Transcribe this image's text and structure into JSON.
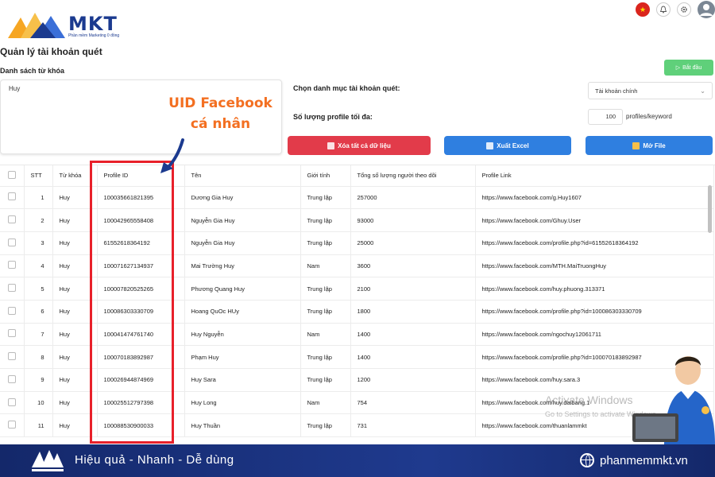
{
  "brand": {
    "name": "MKT",
    "subtitle": "Phần mềm Marketing 0 đồng",
    "primary": "#1b3a8f",
    "accent": "#f36f21"
  },
  "header": {
    "icons": [
      "vietnam-flag-icon",
      "bell-icon",
      "gear-icon",
      "avatar-icon"
    ]
  },
  "page": {
    "title": "Quản lý tài khoản quét",
    "keyword_section": "Danh sách từ khóa",
    "keyword_value": "Huy",
    "start_button": "Bắt đầu",
    "category_label": "Chọn danh mục tài khoản quét:",
    "category_value": "Tài khoản chính",
    "profile_count_label": "Số lượng profile tối đa:",
    "profile_count_value": "100",
    "profile_count_unit": "profiles/keyword",
    "btn_clear": "Xóa tất cả dữ liệu",
    "btn_excel": "Xuất Excel",
    "btn_file": "Mở File"
  },
  "annotation": {
    "line1": "UID Facebook",
    "line2": "cá nhân"
  },
  "table": {
    "headers": [
      "STT",
      "Từ khóa",
      "Profile ID",
      "Tên",
      "Giới tính",
      "Tổng số lượng người theo dõi",
      "Profile Link"
    ],
    "rows": [
      [
        "1",
        "Huy",
        "100035661821395",
        "Dương Gia Huy",
        "Trung lập",
        "257000",
        "https://www.facebook.com/g.Huy1607"
      ],
      [
        "2",
        "Huy",
        "100042965558408",
        "Nguyễn Gia Huy",
        "Trung lập",
        "93000",
        "https://www.facebook.com/Ghuy.User"
      ],
      [
        "3",
        "Huy",
        "61552618364192",
        "Nguyễn Gia Huy",
        "Trung lập",
        "25000",
        "https://www.facebook.com/profile.php?id=61552618364192"
      ],
      [
        "4",
        "Huy",
        "100071627134937",
        "Mai Trường Huy",
        "Nam",
        "3600",
        "https://www.facebook.com/MTH.MaiTruongHuy"
      ],
      [
        "5",
        "Huy",
        "100007820525265",
        "Phương Quang Huy",
        "Trung lập",
        "2100",
        "https://www.facebook.com/huy.phuong.313371"
      ],
      [
        "6",
        "Huy",
        "100086303330709",
        "Hoang QuOc HUy",
        "Trung lập",
        "1800",
        "https://www.facebook.com/profile.php?id=100086303330709"
      ],
      [
        "7",
        "Huy",
        "100041474761740",
        "Huy Nguyễn",
        "Nam",
        "1400",
        "https://www.facebook.com/ngochuy12061711"
      ],
      [
        "8",
        "Huy",
        "100070183892987",
        "Phạm Huy",
        "Trung lập",
        "1400",
        "https://www.facebook.com/profile.php?id=100070183892987"
      ],
      [
        "9",
        "Huy",
        "100026944874969",
        "Huy Sara",
        "Trung lập",
        "1200",
        "https://www.facebook.com/huy.sara.3"
      ],
      [
        "10",
        "Huy",
        "100025512797398",
        "Huy Long",
        "Nam",
        "754",
        "https://www.facebook.com/huy.daibang.1"
      ],
      [
        "11",
        "Huy",
        "100088530900033",
        "Huy Thuần",
        "Trung lập",
        "731",
        "https://www.facebook.com/thuanlammkt"
      ]
    ]
  },
  "watermark": {
    "line1": "Activate Windows",
    "line2": "Go to Settings to activate Windows."
  },
  "footer": {
    "tagline": "Hiệu quả - Nhanh - Dễ dùng",
    "website": "phanmemmkt.vn"
  }
}
